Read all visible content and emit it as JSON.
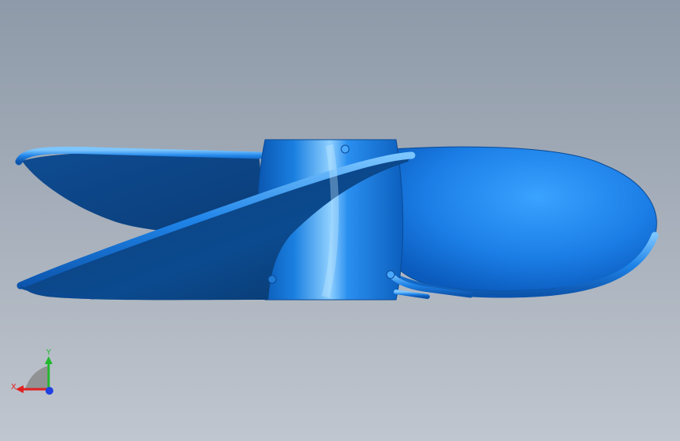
{
  "viewport": {
    "background_top": "#8e9aa9",
    "background_bottom": "#c0c6cf"
  },
  "model": {
    "name": "propeller",
    "color": "#1f7bd6"
  },
  "triad": {
    "x_label": "X",
    "y_label": "Y",
    "x_color": "#e02020",
    "y_color": "#22b830",
    "z_color": "#2040e0"
  }
}
